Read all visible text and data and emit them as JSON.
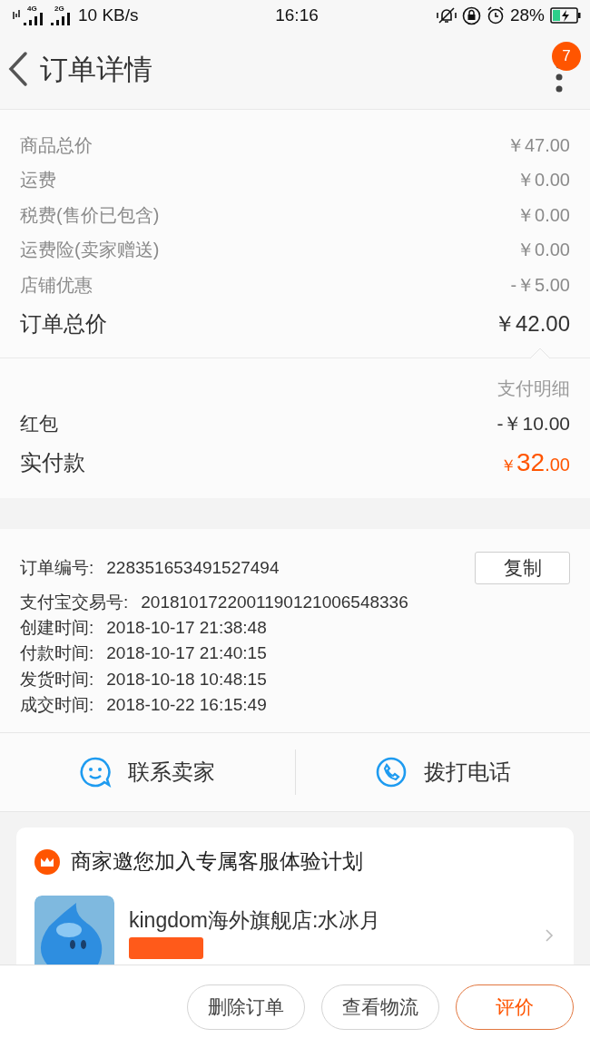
{
  "status_bar": {
    "network_1": "4G",
    "network_2": "2G",
    "speed": "10 KB/s",
    "time": "16:16",
    "battery": "28%"
  },
  "nav": {
    "title": "订单详情",
    "badge": "7"
  },
  "price_rows": [
    {
      "kind": "normal",
      "label": "商品总价",
      "value": "￥47.00"
    },
    {
      "kind": "normal",
      "label": "运费",
      "value": "￥0.00"
    },
    {
      "kind": "normal",
      "label": "税费(售价已包含)",
      "value": "￥0.00"
    },
    {
      "kind": "normal",
      "label": "运费险(卖家赠送)",
      "value": "￥0.00"
    },
    {
      "kind": "normal",
      "label": "店铺优惠",
      "value": "-￥5.00"
    },
    {
      "kind": "total",
      "label": "订单总价",
      "value": "￥42.00"
    }
  ],
  "payment": {
    "header": "支付明细",
    "rows": [
      {
        "label": "红包",
        "value": "-￥10.00"
      }
    ],
    "paid": {
      "label": "实付款",
      "currency": "￥",
      "integer": "32",
      "decimal": ".00"
    }
  },
  "order_info": {
    "rows": [
      {
        "label": "订单编号:",
        "value": "228351653491527494"
      },
      {
        "label": "支付宝交易号:",
        "value": "2018101722001190121006548336"
      },
      {
        "label": "创建时间:",
        "value": "2018-10-17 21:38:48"
      },
      {
        "label": "付款时间:",
        "value": "2018-10-17 21:40:15"
      },
      {
        "label": "发货时间:",
        "value": "2018-10-18 10:48:15"
      },
      {
        "label": "成交时间:",
        "value": "2018-10-22 16:15:49"
      }
    ],
    "copy_button": "复制"
  },
  "contact": [
    {
      "kind": "chat",
      "label": "联系卖家"
    },
    {
      "kind": "phone",
      "label": "拨打电话"
    }
  ],
  "invite_card": {
    "title": "商家邀您加入专属客服体验计划",
    "shop_name": "kingdom海外旗舰店:水冰月"
  },
  "footer_buttons": [
    {
      "kind": "normal",
      "label": "删除订单"
    },
    {
      "kind": "normal",
      "label": "查看物流"
    },
    {
      "kind": "primary",
      "label": "评价"
    }
  ]
}
